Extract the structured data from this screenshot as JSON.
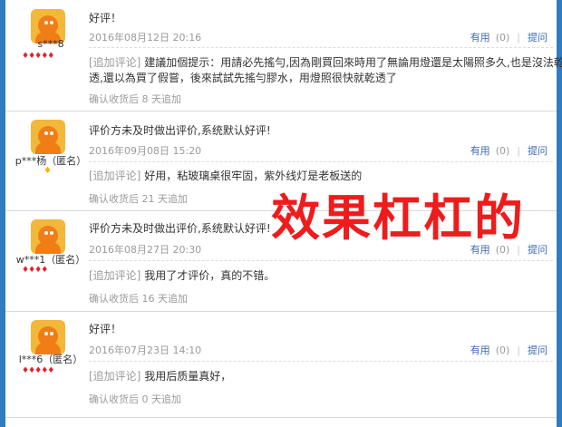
{
  "reviews": [
    {
      "user": "s***8",
      "rank": "♦♦♦♦♦",
      "rank_type": "red",
      "text": "好评！",
      "date": "2016年08月12日 20:16",
      "useful_label": "有用",
      "useful_count": "(0)",
      "ask_label": "提问",
      "append_tag": "[追加评论]",
      "append_lines": [
        "建議加個提示：用請必先搖勻,因為剛買回來時用了無論用燈還是太陽照多久,也是沒法乾",
        "透,還以為買了假嘗，後來試試先搖勻膠水，用燈照很快就乾透了"
      ],
      "after": "确认收货后 8 天追加"
    },
    {
      "user": "p***杨（匿名）",
      "rank": "♦",
      "rank_type": "gold",
      "text": "评价方未及时做出评价,系统默认好评!",
      "date": "2016年09月08日 15:20",
      "useful_label": "有用",
      "useful_count": "(0)",
      "ask_label": "提问",
      "append_tag": "[追加评论]",
      "append_lines": [
        "好用，粘玻璃桌很牢固，紫外线灯是老板送的"
      ],
      "after": "确认收货后 21 天追加"
    },
    {
      "user": "w***1（匿名）",
      "rank": "♦♦♦♦",
      "rank_type": "red",
      "text": "评价方未及时做出评价,系统默认好评!",
      "date": "2016年08月27日 20:30",
      "useful_label": "有用",
      "useful_count": "(0)",
      "ask_label": "提问",
      "append_tag": "[追加评论]",
      "append_lines": [
        "我用了才评价，真的不错。"
      ],
      "after": "确认收货后 16 天追加"
    },
    {
      "user": "l***6（匿名）",
      "rank": "♦♦♦♦♦",
      "rank_type": "red",
      "text": "好评！",
      "date": "2016年07月23日 14:10",
      "useful_label": "有用",
      "useful_count": "(0)",
      "ask_label": "提问",
      "append_tag": "[追加评论]",
      "append_lines": [
        "我用后质量真好，"
      ],
      "after": "确认收货后 0 天追加"
    }
  ],
  "overlay_text": "效果杠杠的",
  "colors": {
    "background": "#2f7cc0",
    "link": "#3d6ab3",
    "overlay": "#ee1c1c",
    "avatar": "#f07d16"
  },
  "icons": [
    "avatar-icon",
    "red-diamond-rank-icon",
    "gold-diamond-rank-icon"
  ]
}
